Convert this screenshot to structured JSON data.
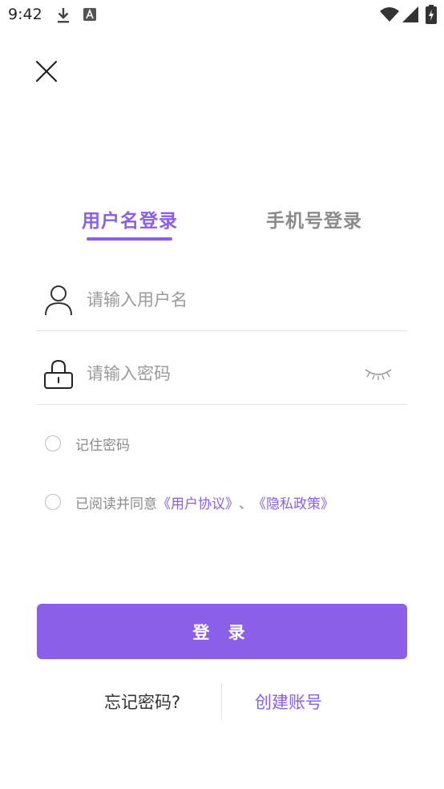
{
  "status_bar": {
    "time": "9:42",
    "icons": [
      "download-icon",
      "a-notification-icon",
      "wifi-icon",
      "signal-icon",
      "battery-icon"
    ]
  },
  "header": {
    "close_icon": "close-icon"
  },
  "tabs": [
    {
      "label": "用户名登录",
      "active": true
    },
    {
      "label": "手机号登录",
      "active": false
    }
  ],
  "form": {
    "username": {
      "value": "",
      "placeholder": "请输入用户名",
      "icon": "user-icon"
    },
    "password": {
      "value": "",
      "placeholder": "请输入密码",
      "icon": "lock-icon",
      "toggle_icon": "eye-closed-icon"
    },
    "remember": {
      "label": "记住密码",
      "checked": false
    },
    "agreement": {
      "checked": false,
      "prefix": "已阅读并同意",
      "user_agreement": "《用户协议》",
      "separator": "、",
      "privacy_policy": "《隐私政策》"
    },
    "login_label": "登 录"
  },
  "footer": {
    "forgot_label": "忘记密码?",
    "create_label": "创建账号"
  },
  "colors": {
    "accent": "#8a5fe6",
    "button": "#8c5fe9",
    "placeholder": "#9a9a9a",
    "muted": "#8a8a8a"
  }
}
